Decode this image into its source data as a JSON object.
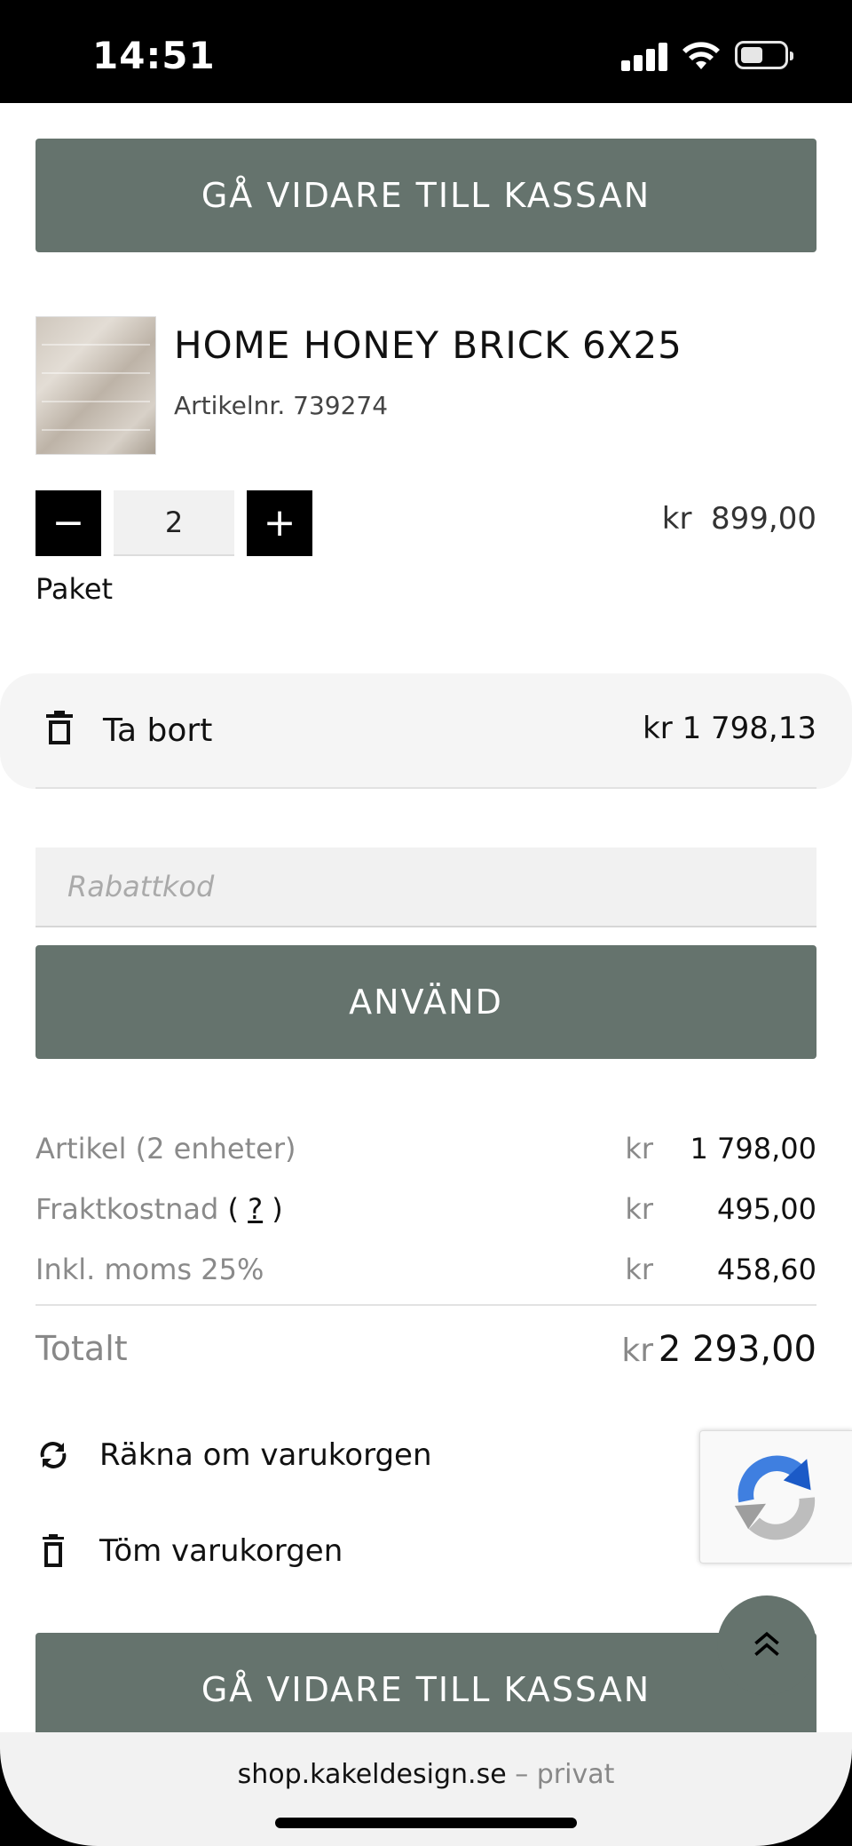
{
  "status": {
    "time": "14:51",
    "signal_icon": "cellular-signal-icon",
    "wifi_icon": "wifi-icon",
    "battery_icon": "battery-icon"
  },
  "checkout_top_label": "GÅ VIDARE TILL KASSAN",
  "product": {
    "name": "HOME HONEY BRICK 6X25",
    "article": "Artikelnr. 739274",
    "quantity": "2",
    "minus": "−",
    "plus": "+",
    "unit_price": "kr  899,00",
    "unit_label": "Paket",
    "remove_label": "Ta bort",
    "line_total": "kr 1 798,13"
  },
  "coupon": {
    "placeholder": "Rabattkod",
    "apply_label": "ANVÄND"
  },
  "summary": {
    "rows": [
      {
        "label": "Artikel (2 enheter)",
        "currency": "kr",
        "value": "1 798,00"
      },
      {
        "label": "Fraktkostnad",
        "help": "?",
        "currency": "kr",
        "value": "495,00"
      },
      {
        "label": "Inkl. moms 25%",
        "currency": "kr",
        "value": "458,60"
      }
    ],
    "total_label": "Totalt",
    "total_currency": "kr",
    "total_value": "2 293,00"
  },
  "actions": {
    "recalc_label": "Räkna om varukorgen",
    "empty_label": "Töm varukorgen"
  },
  "checkout_bottom_label": "GÅ VIDARE TILL KASSAN",
  "browser": {
    "domain": "shop.kakeldesign.se",
    "separator": "–",
    "mode": "privat"
  },
  "colors": {
    "primary": "#65736d",
    "black": "#000000"
  }
}
